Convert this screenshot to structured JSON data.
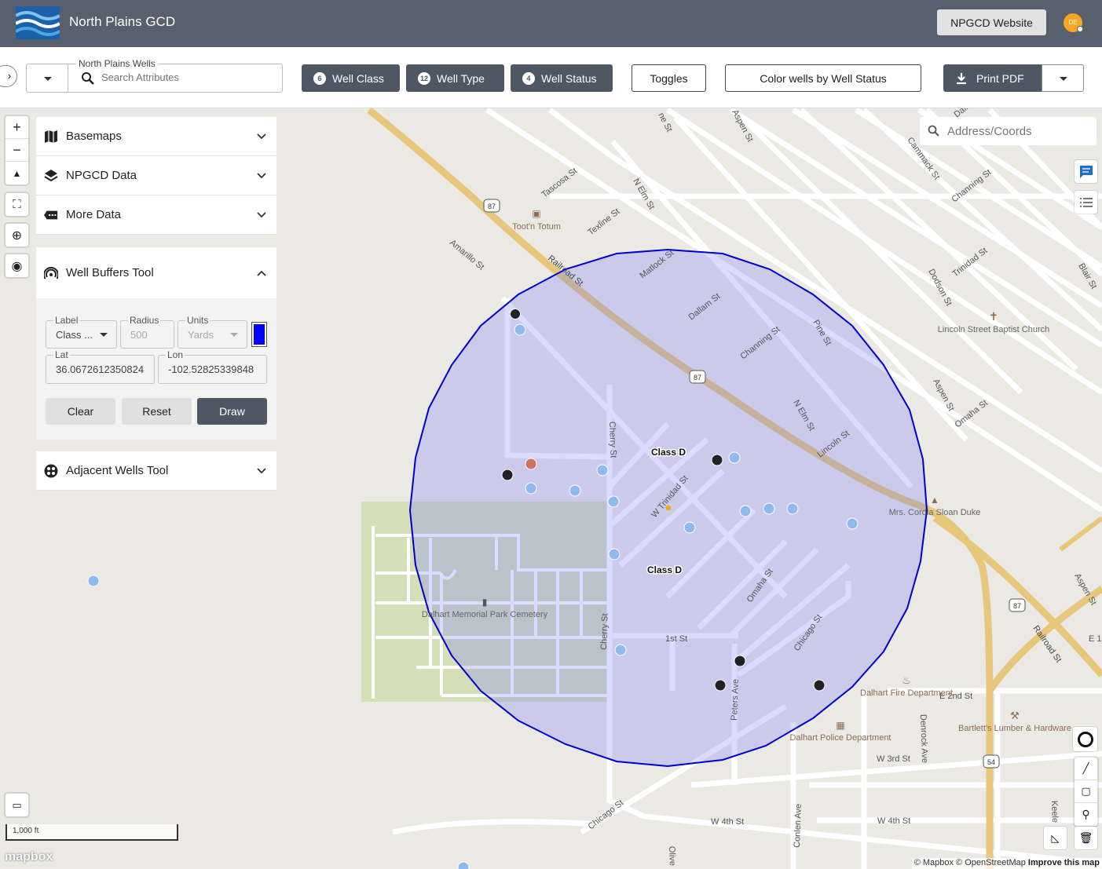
{
  "header": {
    "title": "North Plains GCD",
    "website_button": "NPGCD Website",
    "avatar_initials": "DE"
  },
  "toolbar": {
    "search_legend": "North Plains Wells",
    "search_placeholder": "Search Attributes",
    "filters": [
      {
        "count": "6",
        "label": "Well Class"
      },
      {
        "count": "12",
        "label": "Well Type"
      },
      {
        "count": "4",
        "label": "Well Status"
      }
    ],
    "toggles_label": "Toggles",
    "color_by_label": "Color wells by Well Status",
    "print_label": "Print PDF"
  },
  "panel": {
    "basemaps": "Basemaps",
    "npgcd_data": "NPGCD Data",
    "more_data": "More Data",
    "well_buffers": "Well Buffers Tool",
    "adjacent_wells": "Adjacent Wells Tool",
    "buffer_form": {
      "label_legend": "Label",
      "label_value": "Class ...",
      "radius_legend": "Radius",
      "radius_value": "500",
      "units_legend": "Units",
      "units_value": "Yards",
      "buffer_color": "#0000ff",
      "lat_legend": "Lat",
      "lat_value": "36.0672612350824",
      "lon_legend": "Lon",
      "lon_value": "-102.52825339848",
      "clear": "Clear",
      "reset": "Reset",
      "draw": "Draw"
    }
  },
  "map": {
    "address_placeholder": "Address/Coords",
    "scale_label": "1,000 ft",
    "mapbox": "mapbox",
    "attribution": "© Mapbox © OpenStreetMap",
    "improve": "Improve this map",
    "buffer_color": "#0000cc",
    "class_labels": [
      "Class D",
      "Class D"
    ],
    "streets": [
      "Tascosa St",
      "Texline St",
      "N Elm St",
      "Amarillo St",
      "Railroad St",
      "Matlock St",
      "Dallam St",
      "Channing St",
      "Pine St",
      "Cherry St",
      "W Trinidad St",
      "Omaha St",
      "Chicago St",
      "1st St",
      "Peters Ave",
      "Lincoln St",
      "Aspen St",
      "Dodson St",
      "Trinidad St",
      "Cammack St",
      "Blair St",
      "Channing St",
      "N Elm St",
      "Denrock Ave",
      "E 2nd St",
      "W 3rd St",
      "W 4th St",
      "W 4th St",
      "Conlen Ave",
      "Olive",
      "Keele",
      "Chicago St",
      "Cherry St",
      "Railroad St",
      "Aspen St",
      "E 1",
      "Omaha St",
      "Aspen St",
      "ne St",
      "Dalla"
    ],
    "pois": [
      "Toot'n Totum",
      "Lincoln Street Baptist Church",
      "Mrs. Cordia Sloan Duke",
      "Dalhart Memorial Park Cemetery",
      "Dalhart Fire Department",
      "Dalhart Police Department",
      "Bartlett's Lumber & Hardware"
    ],
    "route_shields": [
      "87",
      "87",
      "87",
      "54"
    ]
  }
}
